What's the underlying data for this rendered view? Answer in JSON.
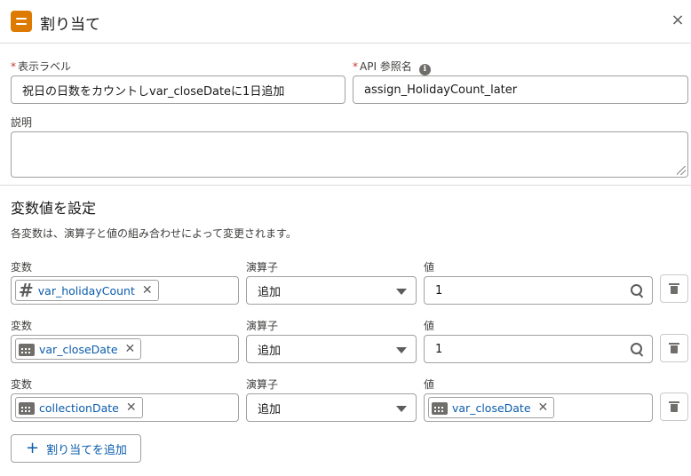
{
  "header": {
    "title": "割り当て"
  },
  "form": {
    "label_field": {
      "label": "表示ラベル",
      "value": "祝日の日数をカウントしvar_closeDateに1日追加"
    },
    "api_field": {
      "label": "API 参照名",
      "value": "assign_HolidayCount_later"
    },
    "description": {
      "label": "説明",
      "value": ""
    }
  },
  "section": {
    "title": "変数値を設定",
    "description": "各変数は、演算子と値の組み合わせによって変更されます。"
  },
  "columns": {
    "variable": "変数",
    "operator": "演算子",
    "value": "値"
  },
  "rows": [
    {
      "variable": "var_holidayCount",
      "variable_icon": "hash-icon",
      "operator": "追加",
      "value": "1",
      "value_type": "text"
    },
    {
      "variable": "var_closeDate",
      "variable_icon": "calendar-icon",
      "operator": "追加",
      "value": "1",
      "value_type": "text"
    },
    {
      "variable": "collectionDate",
      "variable_icon": "calendar-icon",
      "operator": "追加",
      "value": "var_closeDate",
      "value_type": "pill"
    }
  ],
  "add_button": {
    "label": "割り当てを追加"
  },
  "close_icon": "×"
}
